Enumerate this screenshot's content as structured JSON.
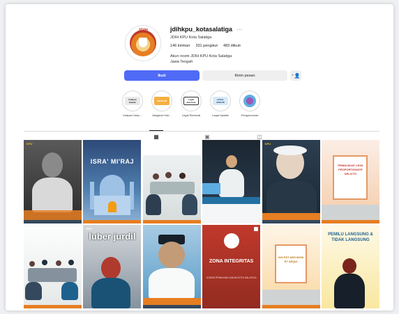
{
  "profile": {
    "logo_text": "JDIH",
    "username": "jdihkpu_kotasalatiga",
    "display_name": "JDIH KPU Kota Salatiga",
    "stats": {
      "posts": "146 kiriman",
      "followers": "331 pengikut",
      "following": "483 diikuti"
    },
    "bio_line1": "Akun resmi JDIH KPU Kota Salatiga",
    "bio_line2": "Jawa Tengah"
  },
  "actions": {
    "follow_label": "Ikuti",
    "message_label": "Kirim pesan",
    "add_icon": "person-add-icon"
  },
  "highlights": [
    {
      "label": "Kutipan Huku...",
      "mark": "Kutipan Hukum"
    },
    {
      "label": "Adagium Huk...",
      "mark": "ADAGIUM"
    },
    {
      "label": "Legal Electoral",
      "mark": "Legal Electoral"
    },
    {
      "label": "Legal Update",
      "mark": "LEGAL UPDATE"
    },
    {
      "label": "Pengumuman",
      "mark": ""
    }
  ],
  "tabs": [
    {
      "icon": "grid-icon"
    },
    {
      "icon": "reels-icon"
    },
    {
      "icon": "tagged-icon"
    }
  ],
  "posts": [
    {
      "brand": "KPU",
      "headline": ""
    },
    {
      "brand": "",
      "headline": "ISRA' MI'RAJ"
    },
    {
      "brand": "",
      "headline": ""
    },
    {
      "brand": "",
      "headline": ""
    },
    {
      "brand": "KPU",
      "headline": ""
    },
    {
      "brand": "",
      "headline": "PRIMA BUAT LESS PROPORTIONATE DELICTO"
    },
    {
      "brand": "",
      "headline": ""
    },
    {
      "brand": "KPU",
      "headline": "luber jurdil"
    },
    {
      "brand": "",
      "headline": ""
    },
    {
      "brand": "",
      "headline": "ZONA INTEGRITAS"
    },
    {
      "brand": "",
      "headline": "IUS EST ARS BONI ET AEQUI"
    },
    {
      "brand": "",
      "headline": "PEMILU LANGSUNG & TIDAK LANGSUNG"
    }
  ],
  "post_subtext": {
    "zona": "KOMISI PEMILIHAN UMUM KOTA SALATIGA"
  },
  "colors": {
    "accent": "#4f6bf6",
    "brand_orange": "#e67e22",
    "kpu_red": "#c0392b"
  }
}
